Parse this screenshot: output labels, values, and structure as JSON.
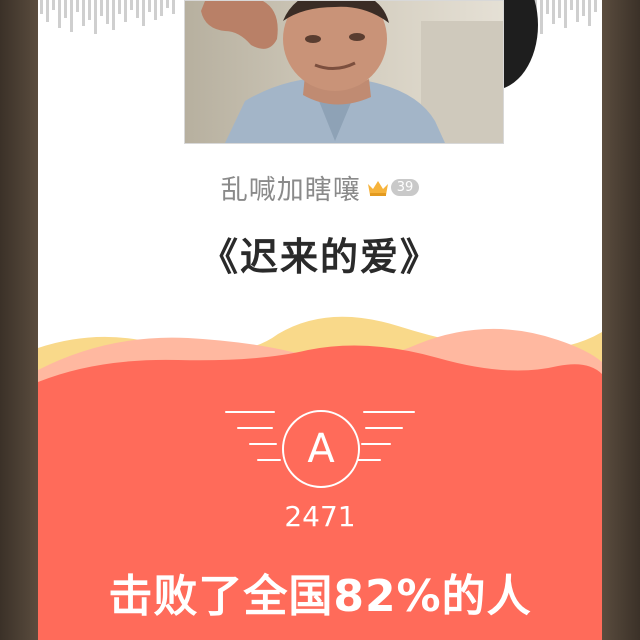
{
  "header": {
    "album_art_alt": "singer-photo"
  },
  "user": {
    "name": "乱喊加瞎嚷",
    "level": "39",
    "badge_icon": "crown-icon"
  },
  "song": {
    "title": "《迟来的爱》"
  },
  "result": {
    "grade": "A",
    "score": "2471",
    "beat_text": "击败了全国82%的人"
  },
  "colors": {
    "accent": "#ff6b5a",
    "wave_light": "#f9d98a",
    "wave_peach": "#ffb8a0",
    "crown": "#f6b33b"
  }
}
